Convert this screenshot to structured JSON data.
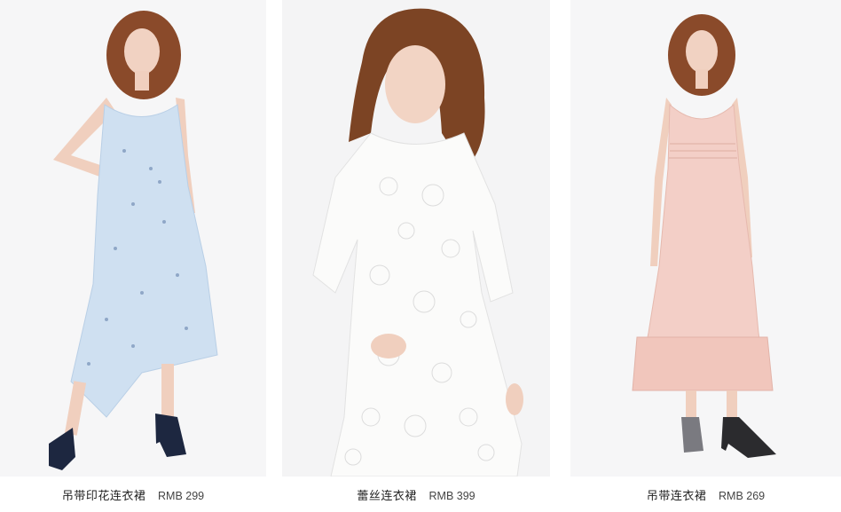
{
  "products": [
    {
      "name": "吊带印花连衣裙",
      "price": "RMB 299",
      "dress_color": "#cfe0f1",
      "photo_icon": "model-photo-floral-slip-dress"
    },
    {
      "name": "蕾丝连衣裙",
      "price": "RMB 399",
      "dress_color": "#fbfbfa",
      "photo_icon": "model-photo-lace-dress"
    },
    {
      "name": "吊带连衣裙",
      "price": "RMB 269",
      "dress_color": "#f3cfc7",
      "photo_icon": "model-photo-velvet-slip-dress"
    }
  ]
}
